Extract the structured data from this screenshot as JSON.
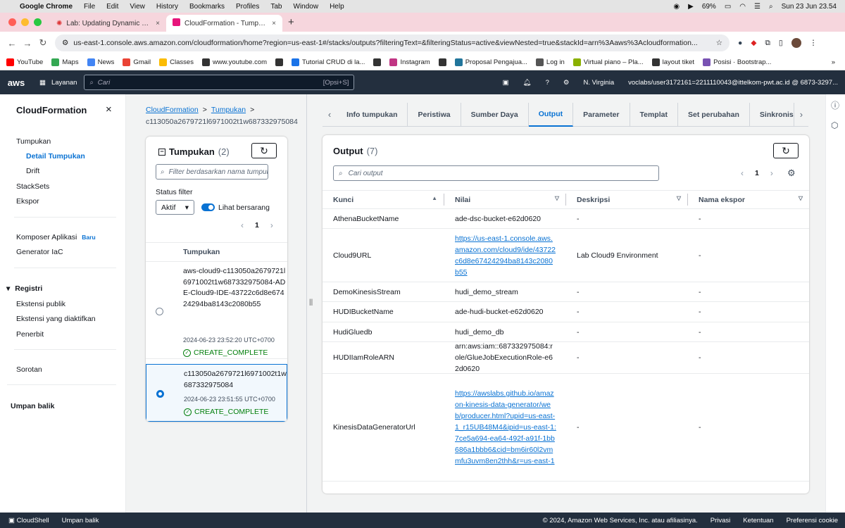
{
  "mac": {
    "apple": "",
    "app": "Google Chrome",
    "menus": [
      "File",
      "Edit",
      "View",
      "History",
      "Bookmarks",
      "Profiles",
      "Tab",
      "Window",
      "Help"
    ],
    "battery": "69%",
    "datetime": "Sun 23 Jun  23.54"
  },
  "tabs": [
    {
      "title": "Lab: Updating Dynamic Data",
      "close": "×"
    },
    {
      "title": "CloudFormation - Tumpukan",
      "close": "×"
    }
  ],
  "new_tab": "+",
  "address": {
    "url": "us-east-1.console.aws.amazon.com/cloudformation/home?region=us-east-1#/stacks/outputs?filteringText=&filteringStatus=active&viewNested=true&stackId=arn%3Aaws%3Acloudformation..."
  },
  "bookmarks": [
    {
      "label": "YouTube",
      "color": "#ff0000"
    },
    {
      "label": "Maps",
      "color": "#34a853"
    },
    {
      "label": "News",
      "color": "#4285f4"
    },
    {
      "label": "Gmail",
      "color": "#ea4335"
    },
    {
      "label": "Classes",
      "color": "#fbbc04"
    },
    {
      "label": "www.youtube.com",
      "color": "#333333"
    },
    {
      "label": "",
      "color": "#333333"
    },
    {
      "label": "Tutorial CRUD di la...",
      "color": "#1a73e8"
    },
    {
      "label": "",
      "color": "#333333"
    },
    {
      "label": "Instagram",
      "color": "#c13584"
    },
    {
      "label": "",
      "color": "#333333"
    },
    {
      "label": "Proposal Pengajua...",
      "color": "#21759b"
    },
    {
      "label": "Log in",
      "color": "#555555"
    },
    {
      "label": "Virtual piano – Pla...",
      "color": "#8ab000"
    },
    {
      "label": "layout tiket",
      "color": "#333333"
    },
    {
      "label": "Posisi · Bootstrap...",
      "color": "#7952b3"
    }
  ],
  "bm_more": "»",
  "aws": {
    "logo": "aws",
    "services": "Layanan",
    "search_placeholder": "Cari",
    "search_shortcut": "[Opsi+S]",
    "region": "N. Virginia",
    "account": "voclabs/user3172161=2211110043@ittelkom-pwt.ac.id @ 6873-3297..."
  },
  "sidebar": {
    "title": "CloudFormation",
    "close": "×",
    "items": [
      {
        "label": "Tumpukan"
      },
      {
        "label": "Detail Tumpukan"
      },
      {
        "label": "Drift"
      },
      {
        "label": "StackSets"
      },
      {
        "label": "Ekspor"
      },
      {
        "label": "Komposer Aplikasi",
        "badge": "Baru"
      },
      {
        "label": "Generator IaC"
      },
      {
        "label": "Registri"
      },
      {
        "label": "Ekstensi publik"
      },
      {
        "label": "Ekstensi yang diaktifkan"
      },
      {
        "label": "Penerbit"
      },
      {
        "label": "Sorotan"
      },
      {
        "label": "Umpan balik"
      }
    ]
  },
  "breadcrumb": {
    "root": "CloudFormation",
    "sep": ">",
    "level2": "Tumpukan",
    "current": "c113050a2679721l6971002t1w687332975084"
  },
  "stacks": {
    "title": "Tumpukan",
    "count": "(2)",
    "filter_placeholder": "Filter berdasarkan nama tumpukan",
    "status_label": "Status filter",
    "status_value": "Aktif",
    "nested_label": "Lihat bersarang",
    "page": "1",
    "column": "Tumpukan",
    "rows": [
      {
        "name": "aws-cloud9-c113050a2679721l6971002t1w687332975084-ADE-Cloud9-IDE-43722c6d8e67424294ba8143c2080b55",
        "date": "2024-06-23 23:52:20 UTC+0700",
        "status": "CREATE_COMPLETE"
      },
      {
        "name": "c113050a2679721l6971002t1w687332975084",
        "date": "2024-06-23 23:51:55 UTC+0700",
        "status": "CREATE_COMPLETE"
      }
    ]
  },
  "detail_tabs": [
    "Info tumpukan",
    "Peristiwa",
    "Sumber Daya",
    "Output",
    "Parameter",
    "Templat",
    "Set perubahan",
    "Sinkronisasi Git"
  ],
  "outputs": {
    "title": "Output",
    "count": "(7)",
    "search_placeholder": "Cari output",
    "page": "1",
    "columns": [
      "Kunci",
      "Nilai",
      "Deskripsi",
      "Nama ekspor"
    ],
    "rows": [
      {
        "key": "AthenaBucketName",
        "value": "ade-dsc-bucket-e62d0620",
        "desc": "-",
        "export": "-"
      },
      {
        "key": "Cloud9URL",
        "value": "https://us-east-1.console.aws.amazon.com/cloud9/ide/43722c6d8e67424294ba8143c2080b55",
        "desc": "Lab Cloud9 Environment",
        "export": "-"
      },
      {
        "key": "DemoKinesisStream",
        "value": "hudi_demo_stream",
        "desc": "-",
        "export": "-"
      },
      {
        "key": "HUDIBucketName",
        "value": "ade-hudi-bucket-e62d0620",
        "desc": "-",
        "export": "-"
      },
      {
        "key": "HudiGluedb",
        "value": "hudi_demo_db",
        "desc": "-",
        "export": "-"
      },
      {
        "key": "HUDIIamRoleARN",
        "value": "arn:aws:iam::687332975084:role/GlueJobExecutionRole-e62d0620",
        "desc": "-",
        "export": "-"
      },
      {
        "key": "KinesisDataGeneratorUrl",
        "value": "https://awslabs.github.io/amazon-kinesis-data-generator/web/producer.html?upid=us-east-1_r15UB48M4&ipid=us-east-1:7ce5a694-ea64-492f-a91f-1bb686a1bbb6&cid=bm6ir60l2vmmfu3uvm8en2thh&r=us-east-1",
        "desc": "-",
        "export": "-"
      }
    ]
  },
  "footer": {
    "cloudshell": "CloudShell",
    "feedback": "Umpan balik",
    "copyright": "© 2024, Amazon Web Services, Inc. atau afiliasinya.",
    "privacy": "Privasi",
    "terms": "Ketentuan",
    "cookies": "Preferensi cookie"
  },
  "colors": {
    "aws_nav": "#232f3e",
    "link": "#0972d3",
    "success": "#037f0c",
    "tab_strip": "#f6d6dd"
  }
}
